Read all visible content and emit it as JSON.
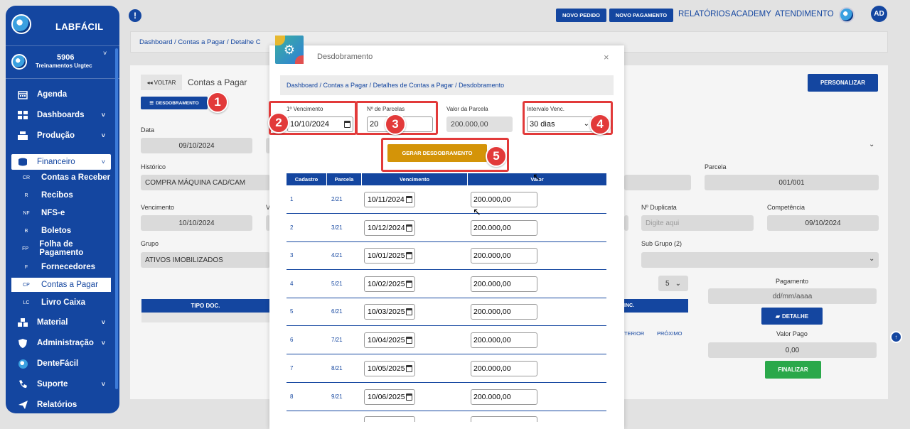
{
  "sidebar": {
    "brand": "LABFÁCIL",
    "user_number": "5906",
    "user_name": "Treinamentos Urgtec",
    "items": [
      {
        "label": "Agenda"
      },
      {
        "label": "Dashboards"
      },
      {
        "label": "Produção"
      },
      {
        "label": "Financeiro"
      },
      {
        "label": "Material"
      },
      {
        "label": "Administração"
      },
      {
        "label": "DenteFácil"
      },
      {
        "label": "Suporte"
      },
      {
        "label": "Relatórios"
      }
    ],
    "financeiro_sub": [
      {
        "abbr": "CR",
        "label": "Contas a Receber"
      },
      {
        "abbr": "R",
        "label": "Recibos"
      },
      {
        "abbr": "NF",
        "label": "NFS-e"
      },
      {
        "abbr": "B",
        "label": "Boletos"
      },
      {
        "abbr": "FP",
        "label": "Folha de Pagamento"
      },
      {
        "abbr": "F",
        "label": "Fornecedores"
      },
      {
        "abbr": "CP",
        "label": "Contas a Pagar"
      },
      {
        "abbr": "LC",
        "label": "Livro Caixa"
      }
    ]
  },
  "topbar": {
    "novo_pedido": "NOVO PEDIDO",
    "novo_pagamento": "NOVO PAGAMENTO",
    "relatorios": "RELATÓRIOS",
    "academy": "ACADEMY",
    "atendimento": "ATENDIMENTO",
    "avatar": "AD"
  },
  "breadcrumb": {
    "text": "Dashboard / Contas a Pagar / Detalhe C"
  },
  "main": {
    "voltar": "VOLTAR",
    "title": "Contas a Pagar",
    "desdobramento_btn": "DESDOBRAMENTO",
    "personalizar": "PERSONALIZAR",
    "data_label": "Data",
    "data_value": "09/10/2024",
    "historico_label": "Histórico",
    "historico_value": "COMPRA MÁQUINA CAD/CAM",
    "parcela_label": "Parcela",
    "parcela_value": "001/001",
    "vencimento_label": "Vencimento",
    "vencimento_value": "10/10/2024",
    "v_label": "V",
    "nduplicata_label": "Nº Duplicata",
    "nduplicata_placeholder": "Digite aqui",
    "competencia_label": "Competência",
    "competencia_value": "09/10/2024",
    "grupo_label": "Grupo",
    "grupo_value": "ATIVOS IMOBILIZADOS",
    "subgrupo_label": "Sub Grupo (2)",
    "page_size": "5",
    "tipo_doc": "TIPO DOC.",
    "inc": "INC.",
    "anterior": "TERIOR",
    "proximo": "PRÓXIMO",
    "pagamento_label": "Pagamento",
    "pagamento_placeholder": "dd/mm/aaaa",
    "detalhe_btn": "DETALHE",
    "valor_pago_label": "Valor Pago",
    "valor_pago": "0,00",
    "finalizar": "FINALIZAR"
  },
  "modal": {
    "title": "Desdobramento",
    "breadcrumb": "Dashboard / Contas a Pagar / Detalhes de Contas a Pagar / Desdobramento",
    "primeiro_venc_label": "1º Vencimento",
    "primeiro_venc_value": "10/10/2024",
    "n_parcelas_label": "Nº de Parcelas",
    "n_parcelas_value": "20",
    "valor_parcela_label": "Valor da Parcela",
    "valor_parcela_value": "200.000,00",
    "intervalo_label": "Intervalo Venc.",
    "intervalo_value": "30 dias",
    "gerar_btn": "GERAR DESDOBRAMENTO",
    "table_headers": [
      "Cadastro",
      "Parcela",
      "Vencimento",
      "Valor"
    ],
    "rows": [
      {
        "cadastro": "1",
        "parcela": "2/21",
        "vencimento": "10/11/2024",
        "valor": "200.000,00"
      },
      {
        "cadastro": "2",
        "parcela": "3/21",
        "vencimento": "10/12/2024",
        "valor": "200.000,00"
      },
      {
        "cadastro": "3",
        "parcela": "4/21",
        "vencimento": "10/01/2025",
        "valor": "200.000,00"
      },
      {
        "cadastro": "4",
        "parcela": "5/21",
        "vencimento": "10/02/2025",
        "valor": "200.000,00"
      },
      {
        "cadastro": "5",
        "parcela": "6/21",
        "vencimento": "10/03/2025",
        "valor": "200.000,00"
      },
      {
        "cadastro": "6",
        "parcela": "7/21",
        "vencimento": "10/04/2025",
        "valor": "200.000,00"
      },
      {
        "cadastro": "7",
        "parcela": "8/21",
        "vencimento": "10/05/2025",
        "valor": "200.000,00"
      },
      {
        "cadastro": "8",
        "parcela": "9/21",
        "vencimento": "10/06/2025",
        "valor": "200.000,00"
      }
    ]
  },
  "annotations": [
    "1",
    "2",
    "3",
    "4",
    "5"
  ],
  "colors": {
    "primary": "#1446a0",
    "accent_red": "#e23a3a",
    "gerar": "#d49408",
    "finalizar": "#2aa84a"
  }
}
